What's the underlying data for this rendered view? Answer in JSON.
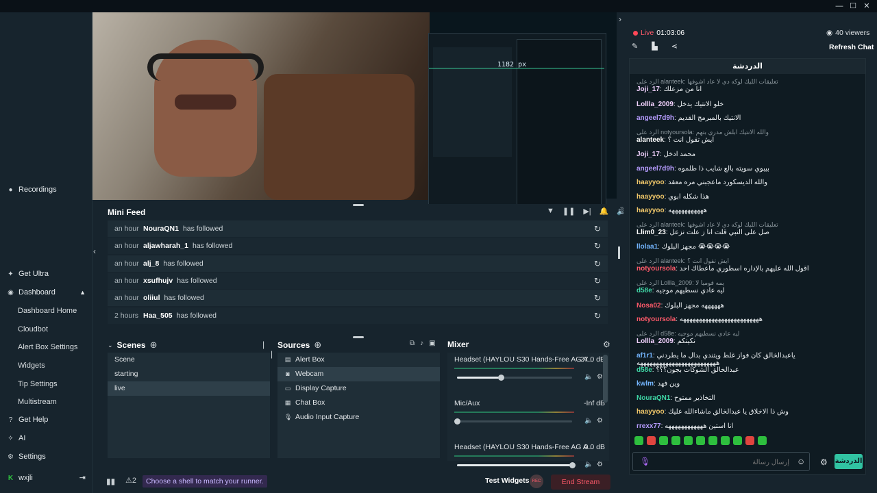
{
  "window": {
    "min": "—",
    "max": "☐",
    "close": "✕"
  },
  "preview": {
    "px_readout": "1182 px"
  },
  "nav": {
    "recordings": "Recordings",
    "get_ultra": "Get Ultra",
    "dashboard": "Dashboard",
    "dashboard_items": [
      "Dashboard Home",
      "Cloudbot",
      "Alert Box Settings",
      "Widgets",
      "Tip Settings",
      "Multistream"
    ],
    "get_help": "Get Help",
    "ai": "AI",
    "settings": "Settings",
    "user": "wxjli"
  },
  "minifeed": {
    "title": "Mini Feed",
    "rows": [
      {
        "time": "an hour",
        "user": "NouraQN1",
        "action": "has followed"
      },
      {
        "time": "an hour",
        "user": "aljawharah_1",
        "action": "has followed"
      },
      {
        "time": "an hour",
        "user": "alj_8",
        "action": "has followed"
      },
      {
        "time": "an hour",
        "user": "xsufhujv",
        "action": "has followed"
      },
      {
        "time": "an hour",
        "user": "oliiul",
        "action": "has followed"
      },
      {
        "time": "2 hours",
        "user": "Haa_505",
        "action": "has followed"
      }
    ]
  },
  "scenes": {
    "title": "Scenes",
    "items": [
      "Scene",
      "starting",
      "live"
    ],
    "selected": 2
  },
  "sources": {
    "title": "Sources",
    "items": [
      "Alert Box",
      "Webcam",
      "Display Capture",
      "Chat Box",
      "Audio Input Capture"
    ],
    "selected": 1
  },
  "mixer": {
    "title": "Mixer",
    "tracks": [
      {
        "name": "Headset (HAYLOU S30 Hands-Free AG A...",
        "db": "-27.0 dB",
        "level": 0.38
      },
      {
        "name": "Mic/Aux",
        "db": "-Inf dB",
        "level": 0.0
      },
      {
        "name": "Headset (HAYLOU S30 Hands-Free AG A...",
        "db": "0.0 dB",
        "level": 1.0
      }
    ]
  },
  "footer": {
    "alert_count": "2",
    "shell_msg": "Choose a shell to match your runner.",
    "test_widgets": "Test Widgets",
    "rec_badge": "REC",
    "end_stream": "End Stream"
  },
  "stream": {
    "live_label": "Live",
    "duration": "01:03:06",
    "viewers": "40 viewers",
    "refresh_chat": "Refresh Chat"
  },
  "chat": {
    "title": "الدردشة",
    "lines": [
      {
        "reply": "الرد على alanteek: تعليقات الليك لوكه دي لا عاد اشوفها",
        "name": "Joji_17",
        "color": "#f3d2ff",
        "msg": "انا من مزعلك"
      },
      {
        "name": "Lollla_2009",
        "color": "#f3d2ff",
        "msg": "خلو الانتيك يدخل"
      },
      {
        "name": "angeel7d9h",
        "color": "#b69cff",
        "msg": "الانتيك بالمبرمج القديم"
      },
      {
        "reply": "الرد على notyoursola: والله الانتيك ابلش مدري بتهم",
        "name": "alanteek",
        "color": "#ffffff",
        "msg": "ايش تقول انت ؟"
      },
      {
        "name": "Joji_17",
        "color": "#f3d2ff",
        "msg": "محمد ادخل"
      },
      {
        "name": "angeel7d9h",
        "color": "#b69cff",
        "msg": "بيبوي سويته بالع شايب ذا طلموه"
      },
      {
        "name": "haayyoo",
        "color": "#f0c76a",
        "msg": "والله الديسكورد ماعجبني مره معقد"
      },
      {
        "name": "haayyoo",
        "color": "#f0c76a",
        "msg": "هذا شكله ابوي"
      },
      {
        "name": "haayyoo",
        "color": "#f0c76a",
        "msg": "هههههههههههه"
      },
      {
        "reply": "الرد على alanteek: تعليقات الليك لوكه دي لا عاد اشوفها",
        "name": "Llim0_23",
        "color": "#ffffff",
        "msg": "صل على النبي قلت انا ز علت نزعل"
      },
      {
        "name": "llolaa1",
        "color": "#74b6ff",
        "msg": "مجهز البلوك 😭😭😭😭"
      },
      {
        "reply": "الرد على alanteek: ايش تقول انت ؟",
        "name": "notyoursola",
        "color": "#ff5a6a",
        "msg": "اقول الله عليهم بالإداره اسطوري ماعطاك احد"
      },
      {
        "reply": "الرد على Lollla_2009: يمه قوميا لا",
        "name": "d58e",
        "color": "#3fd7a6",
        "msg": "ليه عادي نسطيهم موجيه"
      },
      {
        "name": "Nosa02",
        "color": "#ff5a6a",
        "msg": "ههههههه مجهز البلوك"
      },
      {
        "name": "notyoursola",
        "color": "#ff5a6a",
        "msg": "هههههههههههههههههههههههههه"
      },
      {
        "reply": "الرد على d58e: ليه عادي نسطيهم موجيه",
        "name": "Lollla_2009",
        "color": "#f3d2ff",
        "msg": "نكيتكم"
      },
      {
        "name": "af1r1",
        "color": "#74b6ff",
        "msg": "ياعبدالخالق كان فواز غلط ويتندي بدال ما يطردني هههههههههههههههههههههههههه"
      },
      {
        "name": "d58e",
        "color": "#3fd7a6",
        "msg": "عبدالخالق الشوكات بجون؟؟؟"
      },
      {
        "name": "kwlm",
        "color": "#74b6ff",
        "msg": "وين فهد"
      },
      {
        "name": "NouraQN1",
        "color": "#3fd7a6",
        "msg": "التخاذير ممتوح"
      },
      {
        "name": "haayyoo",
        "color": "#f0c76a",
        "msg": "وش ذا الاخلاق يا عبدالخالق ماشاءالله عليك"
      },
      {
        "name": "rrexx77",
        "color": "#b69cff",
        "msg": "انا استين ههههههههههههه"
      }
    ],
    "input_placeholder": "إرسال رسالة",
    "send_label": "الدردشة"
  },
  "colors": {
    "accent": "#31c3a2",
    "live": "#ff4757",
    "end_stream": "#ff5a6a"
  }
}
